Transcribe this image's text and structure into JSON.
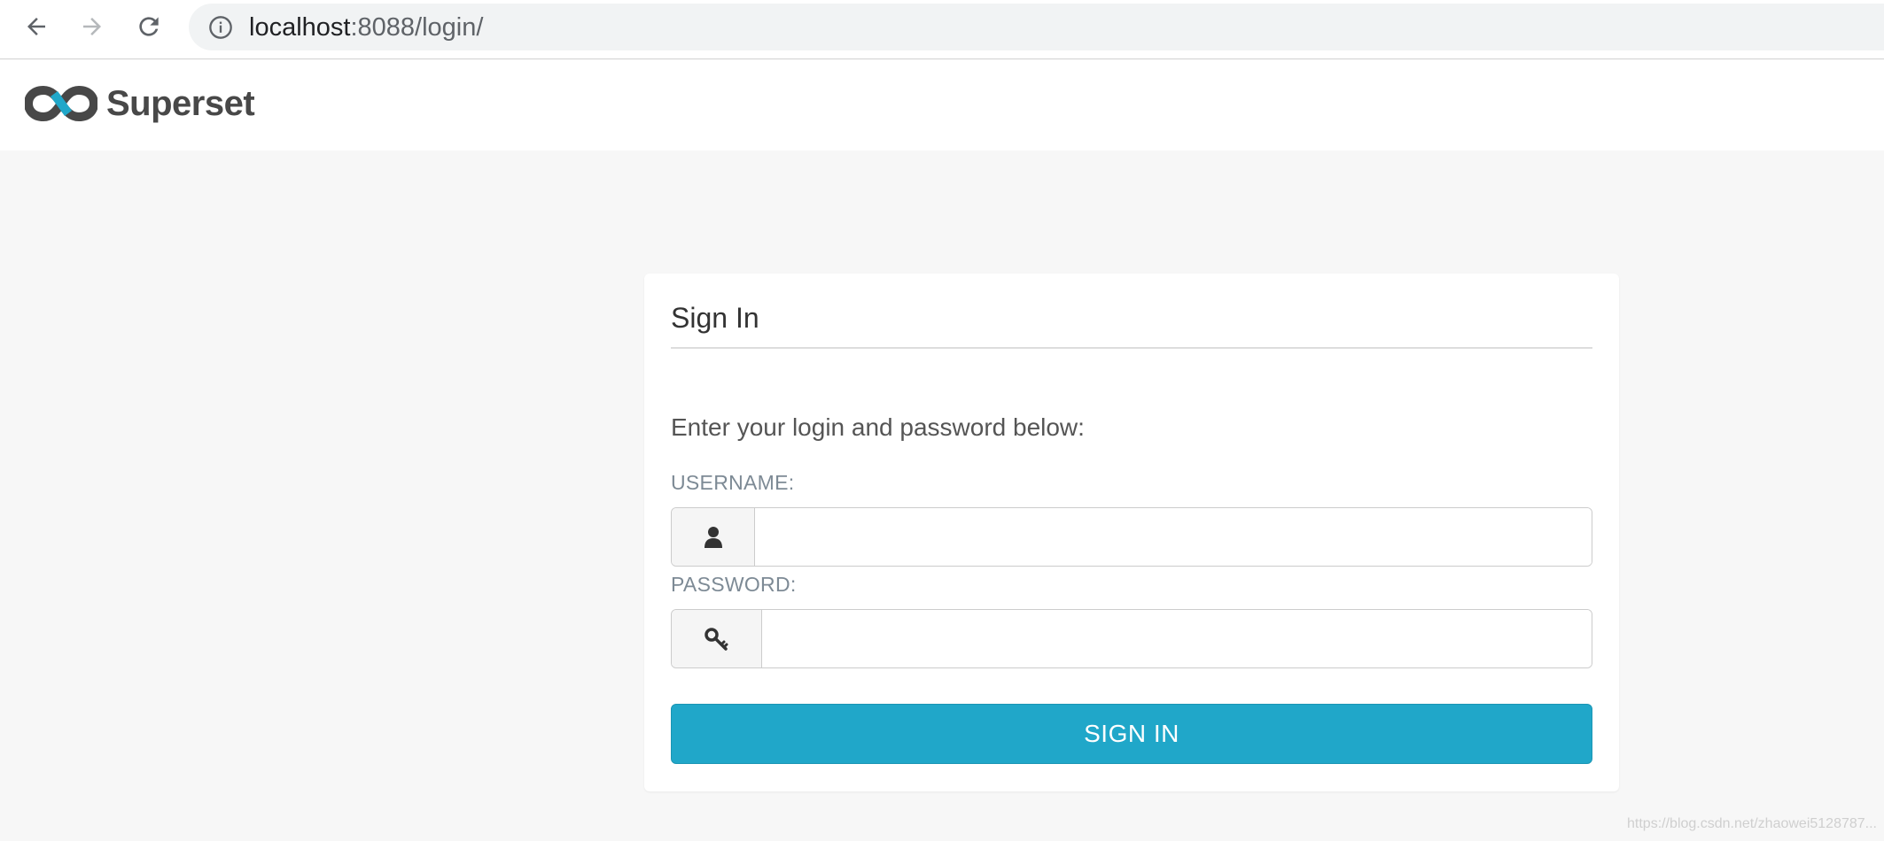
{
  "browser": {
    "url_host": "localhost",
    "url_rest": ":8088/login/"
  },
  "header": {
    "brand_name": "Superset",
    "colors": {
      "logo_dark": "#484848",
      "logo_accent": "#20a7c9"
    }
  },
  "login": {
    "title": "Sign In",
    "instructions": "Enter your login and password below:",
    "username_label": "USERNAME:",
    "username_value": "",
    "username_icon": "user-icon",
    "password_label": "PASSWORD:",
    "password_value": "",
    "password_icon": "key-icon",
    "submit_label": "SIGN IN",
    "colors": {
      "button": "#20a7c9",
      "background": "#f7f7f7"
    }
  },
  "footer": {
    "watermark": "https://blog.csdn.net/zhaowei5128787..."
  }
}
